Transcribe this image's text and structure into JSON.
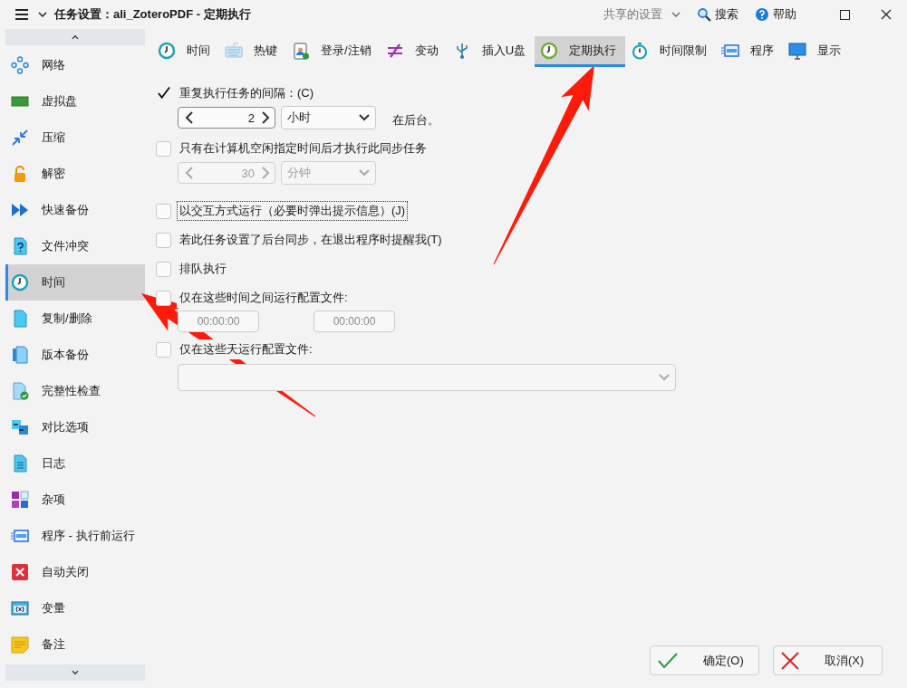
{
  "window": {
    "title": "任务设置：ali_ZoteroPDF - 定期执行",
    "shared_settings": "共享的设置",
    "search": "搜索",
    "help": "帮助"
  },
  "sidebar": {
    "items": [
      {
        "label": "网络",
        "selected": false
      },
      {
        "label": "虚拟盘",
        "selected": false
      },
      {
        "label": "压缩",
        "selected": false
      },
      {
        "label": "解密",
        "selected": false
      },
      {
        "label": "快速备份",
        "selected": false
      },
      {
        "label": "文件冲突",
        "selected": false
      },
      {
        "label": "时间",
        "selected": true
      },
      {
        "label": "复制/删除",
        "selected": false
      },
      {
        "label": "版本备份",
        "selected": false
      },
      {
        "label": "完整性检查",
        "selected": false
      },
      {
        "label": "对比选项",
        "selected": false
      },
      {
        "label": "日志",
        "selected": false
      },
      {
        "label": "杂项",
        "selected": false
      },
      {
        "label": "程序 - 执行前运行",
        "selected": false
      },
      {
        "label": "自动关闭",
        "selected": false
      },
      {
        "label": "变量",
        "selected": false
      },
      {
        "label": "备注",
        "selected": false
      }
    ]
  },
  "tabs": [
    {
      "label": "时间",
      "selected": false
    },
    {
      "label": "热键",
      "selected": false
    },
    {
      "label": "登录/注销",
      "selected": false
    },
    {
      "label": "变动",
      "selected": false
    },
    {
      "label": "插入U盘",
      "selected": false
    },
    {
      "label": "定期执行",
      "selected": true
    },
    {
      "label": "时间限制",
      "selected": false
    },
    {
      "label": "程序",
      "selected": false
    },
    {
      "label": "显示",
      "selected": false
    }
  ],
  "options": [
    {
      "kind": "interval",
      "label": "重复执行任务的间隔：(C)",
      "checked": true,
      "focused": false,
      "value": "2",
      "unit": "小时",
      "suffix": "在后台。",
      "disabled": false
    },
    {
      "kind": "interval",
      "label": "只有在计算机空闲指定时间后才执行此同步任务",
      "checked": false,
      "focused": false,
      "value": "30",
      "unit": "分钟",
      "disabled": true
    },
    {
      "kind": "plain",
      "label": "以交互方式运行（必要时弹出提示信息）(J)",
      "checked": false,
      "focused": true
    },
    {
      "kind": "plain",
      "label": "若此任务设置了后台同步，在退出程序时提醒我(T)",
      "checked": false,
      "focused": false
    },
    {
      "kind": "plain",
      "label": "排队执行",
      "checked": false,
      "focused": false
    },
    {
      "kind": "time_range",
      "label": "仅在这些时间之间运行配置文件:",
      "checked": false,
      "focused": false,
      "from": "00:00:00",
      "to": "00:00:00"
    },
    {
      "kind": "days",
      "label": "仅在这些天运行配置文件:",
      "checked": false,
      "focused": false
    }
  ],
  "buttons": [
    {
      "kind": "ok",
      "label": "确定(O)"
    },
    {
      "kind": "cancel",
      "label": "取消(X)"
    }
  ]
}
